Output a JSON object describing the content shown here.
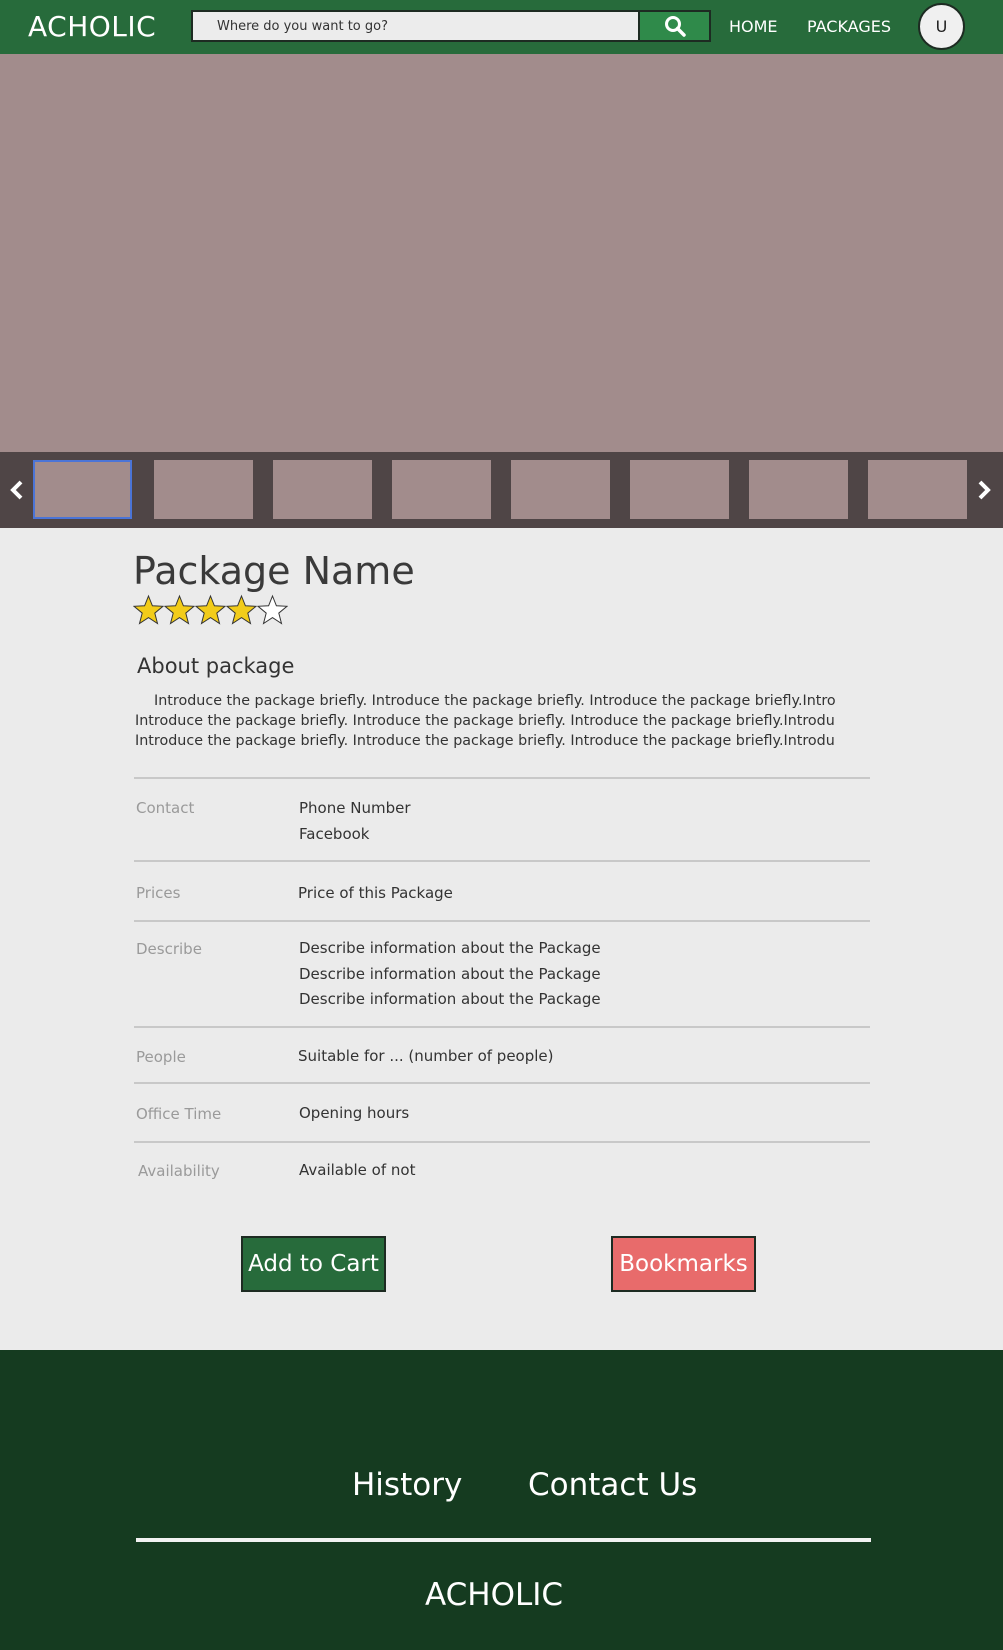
{
  "header": {
    "logo": "ACHOLIC",
    "search_placeholder": "Where do you want to go?",
    "nav": [
      "HOME",
      "PACKAGES"
    ],
    "avatar_initial": "U",
    "colors": {
      "bar": "#276b3b",
      "search_button": "#2f8a4a"
    }
  },
  "gallery": {
    "thumbnail_count": 8,
    "selected_thumbnail": 1,
    "icons": [
      "chevron-left-icon",
      "chevron-right-icon"
    ]
  },
  "package": {
    "name": "Package Name",
    "rating": 4,
    "rating_max": 5,
    "about_heading": "About package",
    "about_lines": [
      "Introduce the package briefly. Introduce the package briefly. Introduce the package briefly.Intro",
      "Introduce the package briefly. Introduce the package briefly. Introduce the package briefly.Introdu",
      "Introduce the package briefly. Introduce the package briefly. Introduce the package briefly.Introdu"
    ],
    "details": {
      "contact": {
        "label": "Contact",
        "values": [
          "Phone Number",
          "Facebook"
        ]
      },
      "prices": {
        "label": "Prices",
        "values": [
          "Price of this Package"
        ]
      },
      "describe": {
        "label": "Describe",
        "values": [
          "Describe information about the Package",
          "Describe information about the Package",
          "Describe information about the Package"
        ]
      },
      "people": {
        "label": "People",
        "values": [
          "Suitable for ... (number of people)"
        ]
      },
      "office_time": {
        "label": "Office Time",
        "values": [
          "Opening hours"
        ]
      },
      "availability": {
        "label": "Availability",
        "values": [
          "Available of not"
        ]
      }
    },
    "actions": {
      "add_to_cart": "Add to Cart",
      "bookmarks": "Bookmarks"
    }
  },
  "footer": {
    "links": [
      "History",
      "Contact Us"
    ],
    "logo": "ACHOLIC",
    "color": "#153b20"
  }
}
